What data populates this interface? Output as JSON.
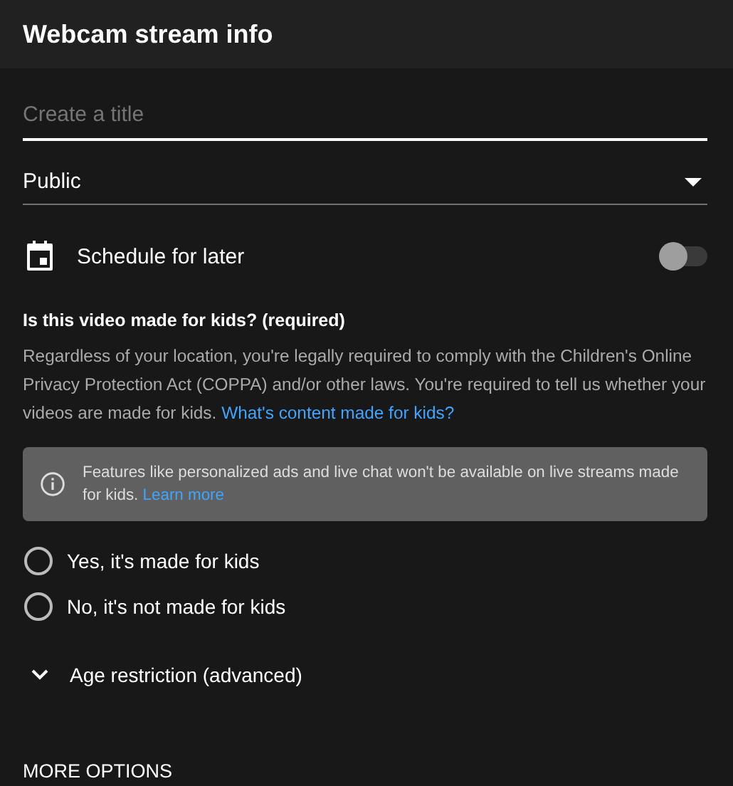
{
  "header": {
    "title": "Webcam stream info"
  },
  "title_field": {
    "placeholder": "Create a title",
    "focused": true
  },
  "visibility": {
    "value": "Public"
  },
  "schedule": {
    "label": "Schedule for later",
    "on": false
  },
  "kids": {
    "question": "Is this video made for kids? (required)",
    "description": "Regardless of your location, you're legally required to comply with the Children's Online Privacy Protection Act (COPPA) and/or other laws. You're required to tell us whether your videos are made for kids.",
    "link": "What's content made for kids?",
    "notice": {
      "text": "Features like personalized ads and live chat won't be available on live streams made for kids.",
      "link": "Learn more"
    },
    "options": [
      {
        "label": "Yes, it's made for kids",
        "selected": false
      },
      {
        "label": "No, it's not made for kids",
        "selected": false
      }
    ]
  },
  "age_restriction": {
    "label": "Age restriction (advanced)",
    "expanded": false
  },
  "more_options": "MORE OPTIONS"
}
